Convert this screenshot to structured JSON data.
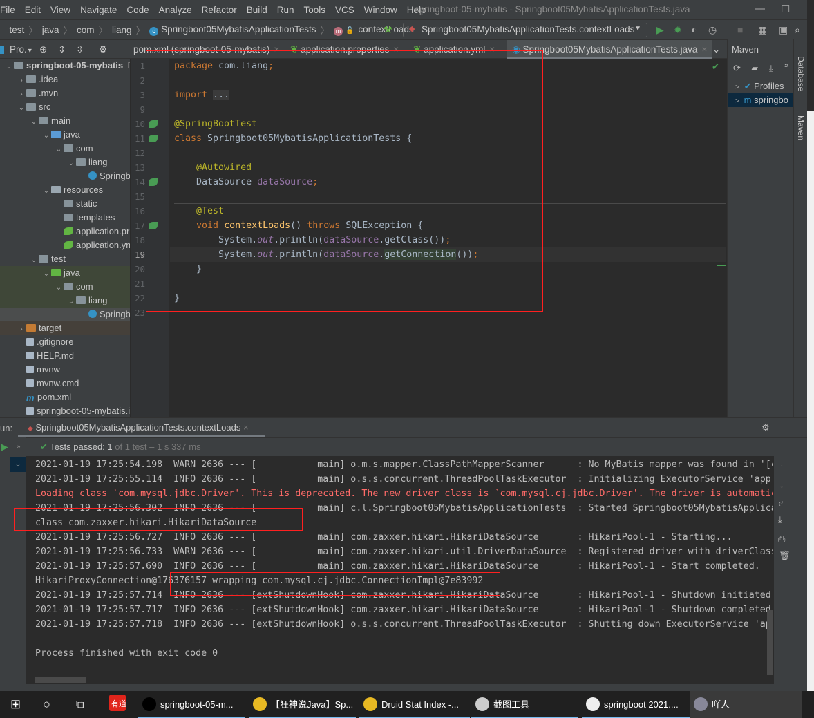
{
  "window": {
    "title": "springboot-05-mybatis - Springboot05MybatisApplicationTests.java"
  },
  "menu": [
    "File",
    "Edit",
    "View",
    "Navigate",
    "Code",
    "Analyze",
    "Refactor",
    "Build",
    "Run",
    "Tools",
    "VCS",
    "Window",
    "Help"
  ],
  "breadcrumb": [
    "test",
    "java",
    "com",
    "liang",
    "Springboot05MybatisApplicationTests",
    "contextLoads"
  ],
  "run_config": "Springboot05MybatisApplicationTests.contextLoads",
  "project_header": "Pro.",
  "editor_tabs": [
    {
      "label": "pom.xml (springboot-05-mybatis)"
    },
    {
      "label": "application.properties"
    },
    {
      "label": "application.yml"
    },
    {
      "label": "Springboot05MybatisApplicationTests.java",
      "active": true
    }
  ],
  "tree": [
    {
      "label": "springboot-05-mybatis",
      "level": 0,
      "arrow": "v",
      "icon": "module",
      "bold": true,
      "suffix": "D:"
    },
    {
      "label": ".idea",
      "level": 1,
      "arrow": ">",
      "icon": "folder"
    },
    {
      "label": ".mvn",
      "level": 1,
      "arrow": ">",
      "icon": "folder"
    },
    {
      "label": "src",
      "level": 1,
      "arrow": "v",
      "icon": "folder"
    },
    {
      "label": "main",
      "level": 2,
      "arrow": "v",
      "icon": "folder"
    },
    {
      "label": "java",
      "level": 3,
      "arrow": "v",
      "icon": "src"
    },
    {
      "label": "com",
      "level": 4,
      "arrow": "v",
      "icon": "pkg"
    },
    {
      "label": "liang",
      "level": 5,
      "arrow": "v",
      "icon": "pkg"
    },
    {
      "label": "Springbo",
      "level": 6,
      "arrow": "",
      "icon": "spring-class"
    },
    {
      "label": "resources",
      "level": 3,
      "arrow": "v",
      "icon": "res"
    },
    {
      "label": "static",
      "level": 4,
      "arrow": "",
      "icon": "folder"
    },
    {
      "label": "templates",
      "level": 4,
      "arrow": "",
      "icon": "folder"
    },
    {
      "label": "application.pro",
      "level": 4,
      "arrow": "",
      "icon": "spring"
    },
    {
      "label": "application.yml",
      "level": 4,
      "arrow": "",
      "icon": "spring"
    },
    {
      "label": "test",
      "level": 2,
      "arrow": "v",
      "icon": "folder"
    },
    {
      "label": "java",
      "level": 3,
      "arrow": "v",
      "icon": "test",
      "hl": true
    },
    {
      "label": "com",
      "level": 4,
      "arrow": "v",
      "icon": "pkg",
      "hl": true
    },
    {
      "label": "liang",
      "level": 5,
      "arrow": "v",
      "icon": "pkg",
      "hl": true
    },
    {
      "label": "Springbo",
      "level": 6,
      "arrow": "",
      "icon": "spring-class",
      "selected": true
    },
    {
      "label": "target",
      "level": 1,
      "arrow": ">",
      "icon": "target",
      "hl2": true
    },
    {
      "label": ".gitignore",
      "level": 1,
      "arrow": "",
      "icon": "file"
    },
    {
      "label": "HELP.md",
      "level": 1,
      "arrow": "",
      "icon": "file"
    },
    {
      "label": "mvnw",
      "level": 1,
      "arrow": "",
      "icon": "file"
    },
    {
      "label": "mvnw.cmd",
      "level": 1,
      "arrow": "",
      "icon": "file"
    },
    {
      "label": "pom.xml",
      "level": 1,
      "arrow": "",
      "icon": "maven"
    },
    {
      "label": "springboot-05-mybatis.i",
      "level": 1,
      "arrow": "",
      "icon": "file"
    }
  ],
  "code": [
    {
      "n": "1",
      "t": [
        [
          "package",
          "kw"
        ],
        [
          " com.liang",
          ""
        ],
        [
          ";",
          "kw"
        ]
      ]
    },
    {
      "n": "2",
      "t": []
    },
    {
      "n": "3",
      "t": [
        [
          "import",
          "kw"
        ],
        [
          " ",
          ""
        ],
        [
          "...",
          "fold"
        ]
      ]
    },
    {
      "n": "9",
      "t": []
    },
    {
      "n": "10",
      "g": "spring",
      "t": [
        [
          "@SpringBootTest",
          "an"
        ]
      ]
    },
    {
      "n": "11",
      "g": "run",
      "t": [
        [
          "class",
          "kw"
        ],
        [
          " Springboot05MybatisApplicationTests {",
          ""
        ]
      ]
    },
    {
      "n": "12",
      "t": []
    },
    {
      "n": "13",
      "t": [
        [
          "    ",
          ""
        ],
        [
          "@Autowired",
          "an"
        ]
      ]
    },
    {
      "n": "14",
      "g": "bean",
      "t": [
        [
          "    DataSource ",
          ""
        ],
        [
          "dataSource",
          "fld"
        ],
        [
          ";",
          "kw"
        ]
      ]
    },
    {
      "n": "15",
      "t": []
    },
    {
      "n": "16",
      "t": [
        [
          "    ",
          ""
        ],
        [
          "@Test",
          "an"
        ]
      ]
    },
    {
      "n": "17",
      "g": "run",
      "t": [
        [
          "    ",
          ""
        ],
        [
          "void",
          "kw"
        ],
        [
          " ",
          ""
        ],
        [
          "contextLoads",
          "fn"
        ],
        [
          "() ",
          ""
        ],
        [
          "throws",
          "kw"
        ],
        [
          " SQLException {",
          ""
        ]
      ]
    },
    {
      "n": "18",
      "t": [
        [
          "        System.",
          ""
        ],
        [
          "out",
          "st"
        ],
        [
          ".println(",
          ""
        ],
        [
          "dataSource",
          "fld"
        ],
        [
          ".getClass())",
          ""
        ],
        [
          ";",
          "kw"
        ]
      ]
    },
    {
      "n": "19",
      "cur": true,
      "t": [
        [
          "        System.",
          ""
        ],
        [
          "out",
          "st"
        ],
        [
          ".println(",
          ""
        ],
        [
          "dataSource",
          "fld"
        ],
        [
          ".",
          ""
        ],
        [
          "getConnection",
          "hlm"
        ],
        [
          "())",
          ""
        ],
        [
          ";",
          "kw"
        ]
      ]
    },
    {
      "n": "20",
      "t": [
        [
          "    }",
          ""
        ]
      ]
    },
    {
      "n": "21",
      "t": []
    },
    {
      "n": "22",
      "t": [
        [
          "}",
          ""
        ]
      ]
    },
    {
      "n": "23",
      "t": []
    }
  ],
  "maven": {
    "title": "Maven",
    "items": [
      "Profiles",
      "springbo"
    ]
  },
  "right_strip": [
    "Database",
    "Maven"
  ],
  "run": {
    "label": "un:",
    "tab": "Springboot05MybatisApplicationTests.contextLoads",
    "status_label": "Tests passed:",
    "status_count": "1",
    "status_rest": "of 1 test – 1 s 337 ms"
  },
  "console": [
    {
      "text": "2021-01-19 17:25:54.198  WARN 2636 --- [           main] o.m.s.mapper.ClassPathMapperScanner      : No MyBatis mapper was found in '[c"
    },
    {
      "text": "2021-01-19 17:25:55.114  INFO 2636 --- [           main] o.s.s.concurrent.ThreadPoolTaskExecutor  : Initializing ExecutorService 'appl"
    },
    {
      "text": "Loading class `com.mysql.jdbc.Driver'. This is deprecated. The new driver class is `com.mysql.cj.jdbc.Driver'. The driver is automatic",
      "err": true
    },
    {
      "text": "2021-01-19 17:25:56.302  INFO 2636 --- [           main] c.l.Springboot05MybatisApplicationTests  : Started Springboot05MybatisApplica"
    },
    {
      "text": "class com.zaxxer.hikari.HikariDataSource"
    },
    {
      "text": "2021-01-19 17:25:56.727  INFO 2636 --- [           main] com.zaxxer.hikari.HikariDataSource       : HikariPool-1 - Starting..."
    },
    {
      "text": "2021-01-19 17:25:56.733  WARN 2636 --- [           main] com.zaxxer.hikari.util.DriverDataSource  : Registered driver with driverClass"
    },
    {
      "text": "2021-01-19 17:25:57.690  INFO 2636 --- [           main] com.zaxxer.hikari.HikariDataSource       : HikariPool-1 - Start completed."
    },
    {
      "text": "HikariProxyConnection@176376157 wrapping com.mysql.cj.jdbc.ConnectionImpl@7e83992"
    },
    {
      "text": "2021-01-19 17:25:57.714  INFO 2636 --- [extShutdownHook] com.zaxxer.hikari.HikariDataSource       : HikariPool-1 - Shutdown initiated."
    },
    {
      "text": "2021-01-19 17:25:57.717  INFO 2636 --- [extShutdownHook] com.zaxxer.hikari.HikariDataSource       : HikariPool-1 - Shutdown completed."
    },
    {
      "text": "2021-01-19 17:25:57.718  INFO 2636 --- [extShutdownHook] o.s.s.concurrent.ThreadPoolTaskExecutor  : Shutting down ExecutorService 'app"
    },
    {
      "text": ""
    },
    {
      "text": "Process finished with exit code 0"
    }
  ],
  "taskbar": [
    {
      "label": "有道",
      "icon": "youdao"
    },
    {
      "label": "springboot-05-m...",
      "icon": "intellij"
    },
    {
      "label": "【狂神说Java】Sp...",
      "icon": "chrome"
    },
    {
      "label": "Druid Stat Index -...",
      "icon": "chrome"
    },
    {
      "label": "截图工具",
      "icon": "snipping"
    },
    {
      "label": "springboot 2021....",
      "icon": "typora"
    },
    {
      "label": "吖人",
      "icon": "avatar"
    }
  ],
  "colors": {
    "annotation_box": "#ff2020",
    "keyword": "#cc7832",
    "annotation": "#bbb529",
    "field": "#9876aa",
    "error": "#ff6b68",
    "success": "#499c54"
  }
}
